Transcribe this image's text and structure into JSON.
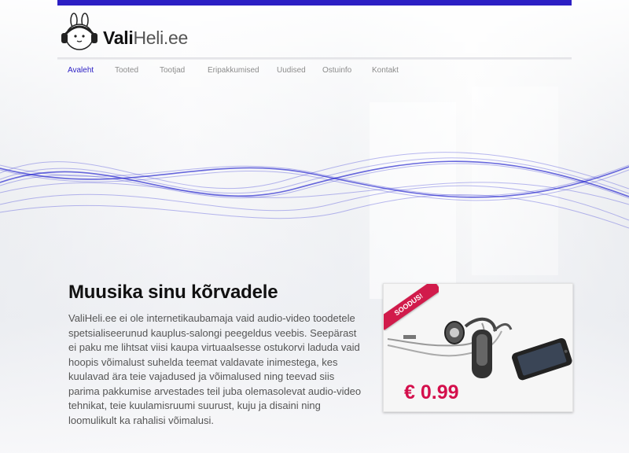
{
  "logo": {
    "vali": "Vali",
    "heli": "Heli.ee",
    "mascot_icon": "bunny-headphones-icon"
  },
  "nav": {
    "items": [
      {
        "label": "Avaleht",
        "active": true
      },
      {
        "label": "Tooted",
        "active": false
      },
      {
        "label": "Tootjad",
        "active": false
      },
      {
        "label": "Eripakkumised",
        "active": false
      },
      {
        "label": "Uudised",
        "active": false
      },
      {
        "label": "Ostuinfo",
        "active": false
      },
      {
        "label": "Kontakt",
        "active": false
      }
    ]
  },
  "hero": {
    "headline": "Muusika sinu kõrvadele",
    "paragraph": "ValiHeli.ee ei ole internetikaubamaja vaid audio-video toodetele spetsialiseerunud kauplus-salongi peegeldus veebis. Seepärast ei paku me lihtsat viisi kaupa virtuaalsesse ostukorvi laduda vaid hoopis võimalust suhelda teemat valdavate inimestega, kes kuulavad ära teie vajadused ja võimalused ning teevad siis parima pakkumise arvestades teil juba olemasolevat audio-video tehnikat, teie kuulamisruumi suurust, kuju ja disaini ning loomulikult ka rahalisi võimalusi."
  },
  "promo": {
    "ribbon": "SOODUS!",
    "price": "€ 0.99",
    "product_icon": "earphones-and-phone-icon"
  },
  "colors": {
    "accent": "#2c1fc4",
    "sale": "#d4104c"
  }
}
